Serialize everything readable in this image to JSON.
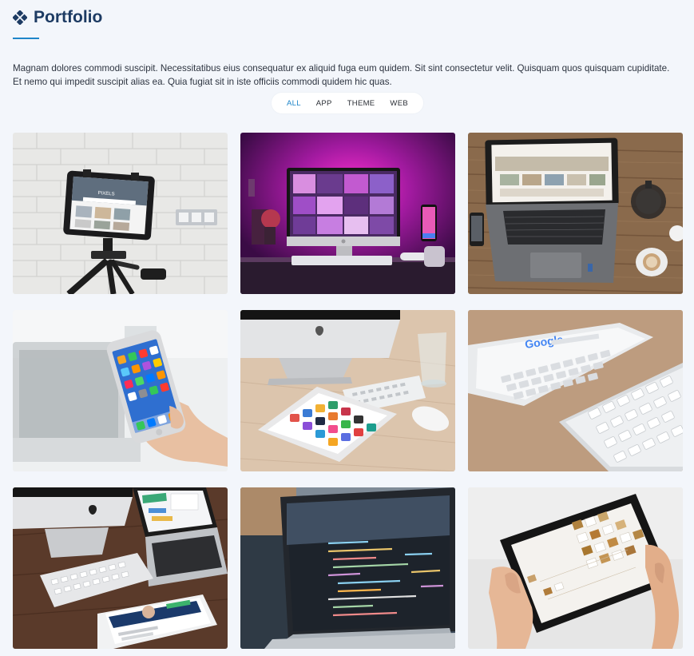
{
  "header": {
    "title": "Portfolio",
    "description": "Magnam dolores commodi suscipit. Necessitatibus eius consequatur ex aliquid fuga eum quidem. Sit sint consectetur velit. Quisquam quos quisquam cupiditate. Et nemo qui impedit suscipit alias ea. Quia fugiat sit in iste officiis commodi quidem hic quas."
  },
  "filters": {
    "all": "ALL",
    "app": "APP",
    "theme": "THEME",
    "web": "WEB",
    "active": "ALL"
  },
  "colors": {
    "accent": "#1f86c9",
    "title": "#1d3b63",
    "background": "#f3f6fb"
  },
  "logos": {
    "google": "Google",
    "pixels": "PIXELS"
  }
}
